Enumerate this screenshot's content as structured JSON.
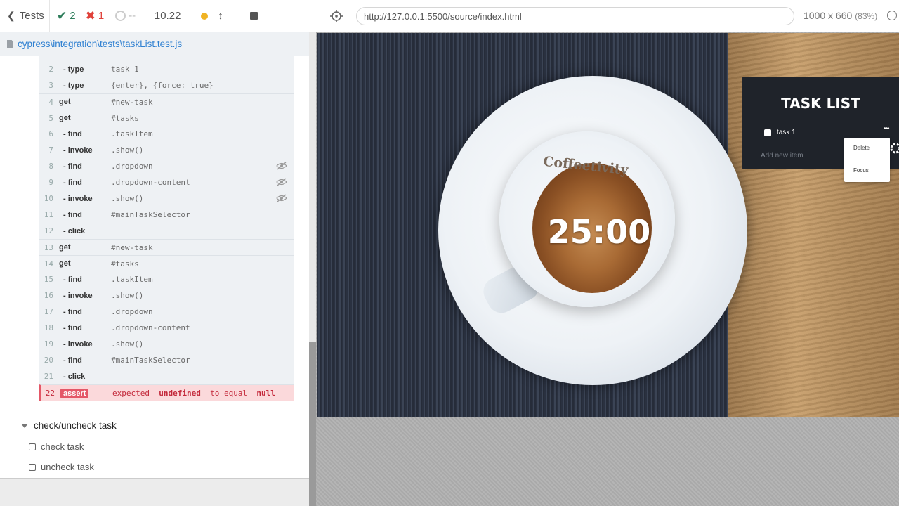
{
  "reporter": {
    "tests_label": "Tests",
    "passed": "2",
    "failed": "1",
    "pending": "--",
    "duration": "10.22"
  },
  "spec_path": "cypress\\integration\\tests\\taskList.test.js",
  "commands": [
    {
      "num": "2",
      "name": "- type",
      "msg": "task 1",
      "child": true,
      "group": false
    },
    {
      "num": "3",
      "name": "- type",
      "msg": "{enter}, {force: true}",
      "child": true,
      "group": false
    },
    {
      "num": "4",
      "name": "get",
      "msg": "#new-task",
      "child": false,
      "group": true
    },
    {
      "num": "5",
      "name": "get",
      "msg": "#tasks",
      "child": false,
      "group": true
    },
    {
      "num": "6",
      "name": "- find",
      "msg": ".taskItem",
      "child": true,
      "group": false
    },
    {
      "num": "7",
      "name": "- invoke",
      "msg": ".show()",
      "child": true,
      "group": false
    },
    {
      "num": "8",
      "name": "- find",
      "msg": ".dropdown",
      "child": true,
      "group": false,
      "hidden": true
    },
    {
      "num": "9",
      "name": "- find",
      "msg": ".dropdown-content",
      "child": true,
      "group": false,
      "hidden": true
    },
    {
      "num": "10",
      "name": "- invoke",
      "msg": ".show()",
      "child": true,
      "group": false,
      "hidden": true
    },
    {
      "num": "11",
      "name": "- find",
      "msg": "#mainTaskSelector",
      "child": true,
      "group": false
    },
    {
      "num": "12",
      "name": "- click",
      "msg": "",
      "child": true,
      "group": false
    },
    {
      "num": "13",
      "name": "get",
      "msg": "#new-task",
      "child": false,
      "group": true
    },
    {
      "num": "14",
      "name": "get",
      "msg": "#tasks",
      "child": false,
      "group": true
    },
    {
      "num": "15",
      "name": "- find",
      "msg": ".taskItem",
      "child": true,
      "group": false
    },
    {
      "num": "16",
      "name": "- invoke",
      "msg": ".show()",
      "child": true,
      "group": false
    },
    {
      "num": "17",
      "name": "- find",
      "msg": ".dropdown",
      "child": true,
      "group": false
    },
    {
      "num": "18",
      "name": "- find",
      "msg": ".dropdown-content",
      "child": true,
      "group": false
    },
    {
      "num": "19",
      "name": "- invoke",
      "msg": ".show()",
      "child": true,
      "group": false
    },
    {
      "num": "20",
      "name": "- find",
      "msg": "#mainTaskSelector",
      "child": true,
      "group": false
    },
    {
      "num": "21",
      "name": "- click",
      "msg": "",
      "child": true,
      "group": false
    }
  ],
  "assertion": {
    "num": "22",
    "tag": "assert",
    "parts": [
      "expected",
      "undefined",
      "to equal",
      "null"
    ]
  },
  "suite": {
    "title": "check/uncheck task",
    "tests": [
      "check task",
      "uncheck task"
    ]
  },
  "aut": {
    "url": "http://127.0.0.1:5500/source/index.html",
    "viewport": "1000 x 660",
    "scale": "(83%)"
  },
  "app": {
    "brand": "Coffeetivity",
    "timer": "25:00",
    "task_list_title": "TASK LIST",
    "task_item": "task 1",
    "task_menu_dots": "•••",
    "add_placeholder": "Add new item",
    "dropdown": [
      "Delete",
      "Focus"
    ]
  },
  "colors": {
    "pass": "#2e7d5b",
    "fail": "#e0413a",
    "assert_bg": "#fbd9db",
    "spec_link": "#2f80d1"
  },
  "icons": [
    "chevron-left-icon",
    "check-icon",
    "x-icon",
    "pending-icon",
    "status-dot-icon",
    "auto-scroll-icon",
    "stop-icon",
    "file-icon",
    "eye-off-icon",
    "crosshair-icon",
    "info-icon",
    "gear-icon"
  ]
}
